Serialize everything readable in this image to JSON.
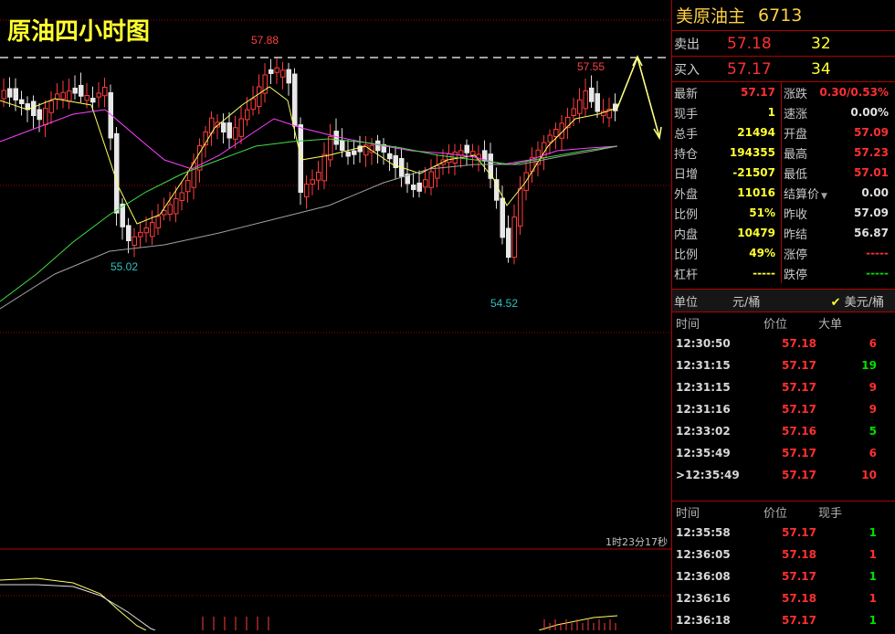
{
  "chart": {
    "title": "原油四小时图",
    "countdown": "1时23分17秒",
    "labels": {
      "high1": "57.88",
      "high2": "57.55",
      "low1": "55.02",
      "low2": "54.52"
    }
  },
  "panel": {
    "name": "美原油主",
    "code": "6713",
    "ask": {
      "label": "卖出",
      "price": "57.18",
      "vol": "32"
    },
    "bid": {
      "label": "买入",
      "price": "57.17",
      "vol": "34"
    },
    "stats": [
      {
        "l": "最新",
        "lv": "57.17",
        "lc": "red",
        "r": "涨跌",
        "rv": "0.30/0.53%",
        "rc": "red"
      },
      {
        "l": "现手",
        "lv": "1",
        "lc": "yel",
        "r": "速涨",
        "rv": "0.00%",
        "rc": "wht"
      },
      {
        "l": "总手",
        "lv": "21494",
        "lc": "yel",
        "r": "开盘",
        "rv": "57.09",
        "rc": "red"
      },
      {
        "l": "持仓",
        "lv": "194355",
        "lc": "yel",
        "r": "最高",
        "rv": "57.23",
        "rc": "red"
      },
      {
        "l": "日增",
        "lv": "-21507",
        "lc": "yel",
        "r": "最低",
        "rv": "57.01",
        "rc": "red"
      },
      {
        "l": "外盘",
        "lv": "11016",
        "lc": "yel",
        "r": "结算价",
        "rv": "0.00",
        "rc": "wht"
      },
      {
        "l": "比例",
        "lv": "51%",
        "lc": "yel",
        "r": "昨收",
        "rv": "57.09",
        "rc": "wht"
      },
      {
        "l": "内盘",
        "lv": "10479",
        "lc": "yel",
        "r": "昨结",
        "rv": "56.87",
        "rc": "wht"
      },
      {
        "l": "比例",
        "lv": "49%",
        "lc": "yel",
        "r": "涨停",
        "rv": "-----",
        "rc": "red"
      },
      {
        "l": "杠杆",
        "lv": "-----",
        "lc": "yel",
        "r": "跌停",
        "rv": "-----",
        "rc": "grn"
      }
    ],
    "unit": {
      "label": "单位",
      "value": "元/桶",
      "check": "美元/桶"
    },
    "table1": {
      "headers": [
        "时间",
        "价位",
        "大单"
      ],
      "rows": [
        {
          "t": "12:30:50",
          "p": "57.18",
          "q": "6",
          "qc": "red"
        },
        {
          "t": "12:31:15",
          "p": "57.17",
          "q": "19",
          "qc": "grn"
        },
        {
          "t": "12:31:15",
          "p": "57.17",
          "q": "9",
          "qc": "red"
        },
        {
          "t": "12:31:16",
          "p": "57.17",
          "q": "9",
          "qc": "red"
        },
        {
          "t": "12:33:02",
          "p": "57.16",
          "q": "5",
          "qc": "grn"
        },
        {
          "t": "12:35:49",
          "p": "57.17",
          "q": "6",
          "qc": "red"
        },
        {
          "t": "12:35:49",
          "p": "57.17",
          "q": "10",
          "qc": "red",
          "mark": ">"
        }
      ]
    },
    "table2": {
      "headers": [
        "时间",
        "价位",
        "现手"
      ],
      "rows": [
        {
          "t": "12:35:58",
          "p": "57.17",
          "q": "1",
          "qc": "grn"
        },
        {
          "t": "12:36:05",
          "p": "57.18",
          "q": "1",
          "qc": "red"
        },
        {
          "t": "12:36:08",
          "p": "57.17",
          "q": "1",
          "qc": "grn"
        },
        {
          "t": "12:36:16",
          "p": "57.18",
          "q": "1",
          "qc": "red"
        },
        {
          "t": "12:36:18",
          "p": "57.17",
          "q": "1",
          "qc": "grn"
        }
      ]
    }
  }
}
